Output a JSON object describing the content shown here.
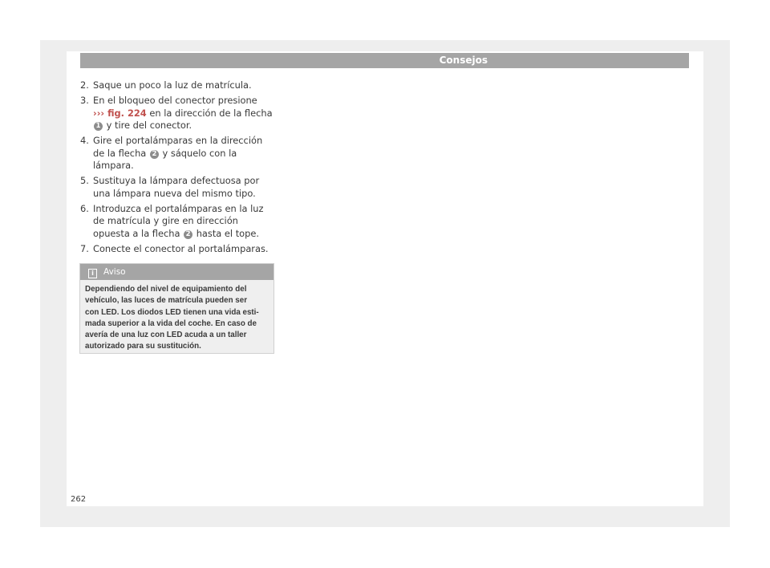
{
  "header": {
    "title": "Consejos"
  },
  "steps": [
    {
      "num": "2.",
      "text": "Saque un poco la luz de matrícula."
    },
    {
      "num": "3.",
      "text_before": "En el bloqueo del conector presione",
      "arrow": "›››",
      "fig_ref": "fig. 224",
      "text_mid": "en la dirección de la flecha",
      "callout": "1",
      "text_after": "y tire del conector."
    },
    {
      "num": "4.",
      "text_before": "Gire el portalámparas en la dirección de la flecha",
      "callout": "2",
      "text_after": "y sáquelo con la lámpara."
    },
    {
      "num": "5.",
      "text": "Sustituya la lámpara defectuosa por una lámpara nueva del mismo tipo."
    },
    {
      "num": "6.",
      "text_before": "Introduzca el portalámparas en la luz de matrícula y gire en dirección opuesta a la flecha",
      "callout": "2",
      "text_after": "hasta el tope."
    },
    {
      "num": "7.",
      "text": "Conecte el conector al portalámparas."
    }
  ],
  "aviso": {
    "title": "Aviso",
    "icon": "info-icon",
    "lines": [
      "Dependiendo del nivel de equipamiento del",
      "vehículo, las luces de matrícula pueden ser",
      "con LED. Los diodos LED tienen una vida esti-",
      "mada superior a la vida del coche. En caso de",
      "avería de una luz con LED acuda a un taller",
      "autorizado para su sustitución."
    ]
  },
  "page_number": "262",
  "colors": {
    "header_bar": "#a5a5a5",
    "reference": "#c0504d",
    "callout": "#8c8c8c",
    "note_bg": "#efefef"
  }
}
